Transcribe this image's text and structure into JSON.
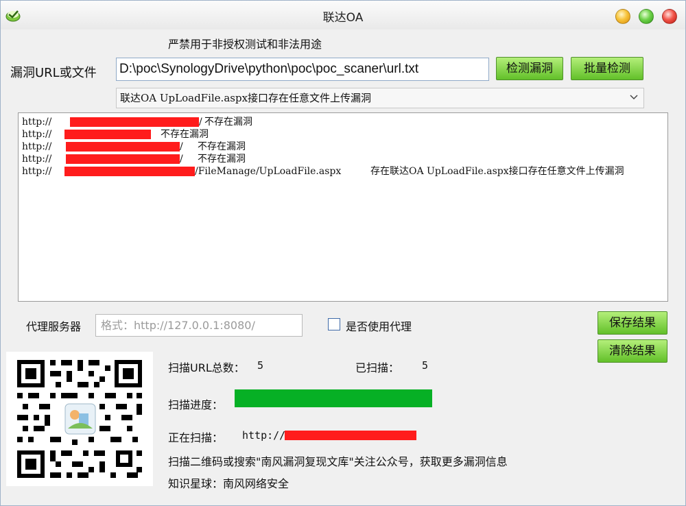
{
  "window": {
    "title": "联达OA",
    "app_icon": "app-logo-icon",
    "buttons": [
      "minimize-icon",
      "maximize-icon",
      "close-icon"
    ]
  },
  "warning_text": "严禁用于非授权测试和非法用途",
  "url_row": {
    "label": "漏洞URL或文件",
    "value": "D:\\poc\\SynologyDrive\\python\\poc\\poc_scaner\\url.txt",
    "detect_button": "检测漏洞",
    "batch_button": "批量检测"
  },
  "vuln_select": {
    "selected": "联达OA UpLoadFile.aspx接口存在任意文件上传漏洞"
  },
  "log": {
    "lines": [
      {
        "prefix": "http://",
        "suffix": "/",
        "result": "不存在漏洞"
      },
      {
        "prefix": "http://",
        "suffix": "",
        "result": "不存在漏洞"
      },
      {
        "prefix": "http://",
        "suffix": "/",
        "result": "不存在漏洞"
      },
      {
        "prefix": "http://",
        "suffix": "/",
        "result": "不存在漏洞"
      },
      {
        "prefix": "http://",
        "suffix": "/FileManage/UpLoadFile.aspx",
        "result": "存在联达OA UpLoadFile.aspx接口存在任意文件上传漏洞"
      }
    ]
  },
  "proxy": {
    "label": "代理服务器",
    "placeholder": "格式：http://127.0.0.1:8080/",
    "use_proxy_label": "是否使用代理",
    "checked": false
  },
  "actions": {
    "save": "保存结果",
    "clear": "清除结果"
  },
  "scan_info": {
    "total_label": "扫描URL总数：",
    "total_value": "5",
    "scanned_label": "已扫描：",
    "scanned_value": "5",
    "progress_label": "扫描进度：",
    "progress_fraction": 1.0,
    "progress_color": "#06b025",
    "current_label": "正在扫描：",
    "current_value": "http://",
    "promo": "扫描二维码或搜索\"南风漏洞复现文库\"关注公众号，获取更多漏洞信息",
    "planet": "知识星球：南风网络安全"
  },
  "qr_code": {
    "icon": "qr-code-icon"
  },
  "colors": {
    "accent_green": "#62c029",
    "redaction_red": "#ff1c1c"
  }
}
